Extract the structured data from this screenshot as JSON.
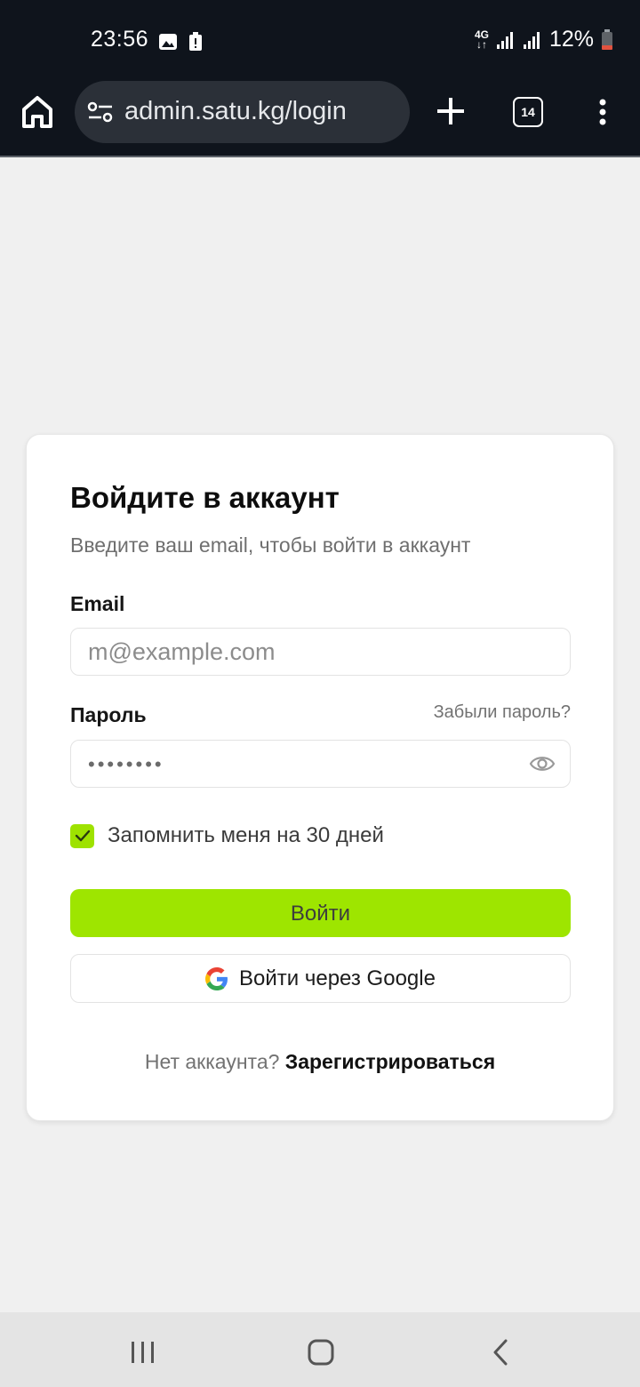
{
  "status_bar": {
    "time": "23:56",
    "network": "4G",
    "battery": "12%"
  },
  "browser": {
    "url": "admin.satu.kg/login",
    "tab_count": "14"
  },
  "login": {
    "title": "Войдите в аккаунт",
    "subtitle": "Введите ваш email, чтобы войти в аккаунт",
    "email_label": "Email",
    "email_placeholder": "m@example.com",
    "email_value": "",
    "password_label": "Пароль",
    "forgot_label": "Забыли пароль?",
    "password_mask": "••••••••",
    "remember_label": "Запомнить меня на 30 дней",
    "remember_checked": true,
    "login_button": "Войти",
    "google_button": "Войти через Google",
    "no_account": "Нет аккаунта?",
    "signup_link": "Зарегистрироваться"
  },
  "colors": {
    "accent": "#9ee500",
    "topbar": "#0f141c",
    "url_pill": "#2b3038"
  },
  "icons": {
    "status": [
      "gallery-icon",
      "alert-icon",
      "signal-icon",
      "battery-icon"
    ],
    "browser": [
      "home-icon",
      "site-settings-icon",
      "new-tab-icon",
      "tabs-icon",
      "menu-icon"
    ],
    "form": [
      "eye-icon",
      "check-icon",
      "google-icon"
    ],
    "nav": [
      "recent-apps-icon",
      "home-nav-icon",
      "back-icon"
    ]
  }
}
